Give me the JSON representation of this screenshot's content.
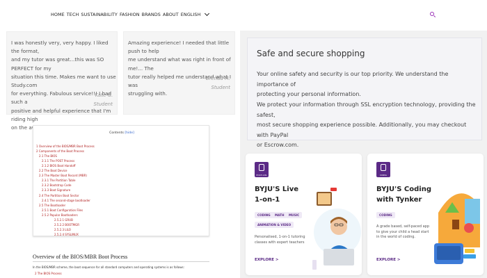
{
  "nav": {
    "items": [
      "HOME",
      "TECH",
      "SUSTAINABILITY",
      "FASHION",
      "BRANDS",
      "ABOUT",
      "ENGLISH"
    ],
    "search_icon": "search-icon",
    "accent": "#9a2fb7"
  },
  "testimonials": [
    {
      "lines": [
        "I was honestly very, very happy. I liked the format,",
        "and my tutor was great...this was SO PERFECT for my",
        "situation this time. Makes me want to use Study.com",
        "for everything. Fabulous service!!! I had such a",
        "positive and helpful experience that I'm riding high",
        "on the awesomeness of it."
      ],
      "author": "Kate G.",
      "role": "Student"
    },
    {
      "lines": [
        "Amazing experience! I needed that little push to help",
        "me understand what was right in front of me!... The",
        "tutor really helped me understand what I was",
        "struggling with."
      ],
      "author": "Brenda M.",
      "role": "Student"
    }
  ],
  "wiki": {
    "contents_title": "Contents",
    "contents_hide": "[hide]",
    "toc": [
      "1 Overview of the BIOS/MBR Boot Process",
      "2 Components of the Boot Process",
      "2.1 The BIOS",
      "2.1.1 The POST Process",
      "2.1.2 BIOS Boot Handoff",
      "2.2 The Boot Device",
      "2.3 The Master Boot Record (MBR)",
      "2.3.1 The Partition Table",
      "2.3.2 Bootstrap Code",
      "2.3.3 Boot Signature",
      "2.4 The Partition Boot Sector",
      "2.4.1 The second-stage bootloader",
      "2.5 The Bootloader",
      "2.5.1 Boot Configuration Files",
      "2.5.2 Popular Bootloaders",
      "2.5.2.1 GRUB",
      "2.5.2.2 BOOTMGR",
      "2.5.2.3 LILO",
      "2.5.2.4 SYSLINUX"
    ],
    "heading": "Overview of the BIOS/MBR Boot Process",
    "paragraph": "In the BIOS/MBR scheme, the boot sequence for all standard computers and operating systems is as follows:",
    "below_item": "2 The BIOS Process"
  },
  "secure": {
    "title": "Safe and secure shopping",
    "para1": [
      "Your online safety and security is our top priority. We understand the importance of",
      "protecting your personal information."
    ],
    "para2": [
      "We protect your information through SSL encryption technology, providing the safest,",
      "most secure shopping experience possible. Additionally, you may checkout with PayPal",
      "or Escrow.com."
    ]
  },
  "products": [
    {
      "logo_label": "BYJU'S LIVE",
      "title_lines": [
        "BYJU'S Live",
        "1-on-1"
      ],
      "chips": [
        "CODING",
        "MATH",
        "MUSIC",
        "ANIMATION & VIDEO"
      ],
      "desc_lines": [
        "Personalised, 1-on-1 tutoring",
        "classes with expert teachers"
      ],
      "explore": "EXPLORE >"
    },
    {
      "logo_label": "CODING",
      "title_lines": [
        "BYJU'S Coding",
        "with Tynker"
      ],
      "chips": [
        "CODING"
      ],
      "desc_lines": [
        "A grade based, self-paced app",
        "to give your child a head start",
        "in the world of coding."
      ],
      "explore": "EXPLORE >"
    }
  ],
  "colors": {
    "brand_purple": "#5b2a86",
    "panel_grey": "#f1f1f1"
  }
}
